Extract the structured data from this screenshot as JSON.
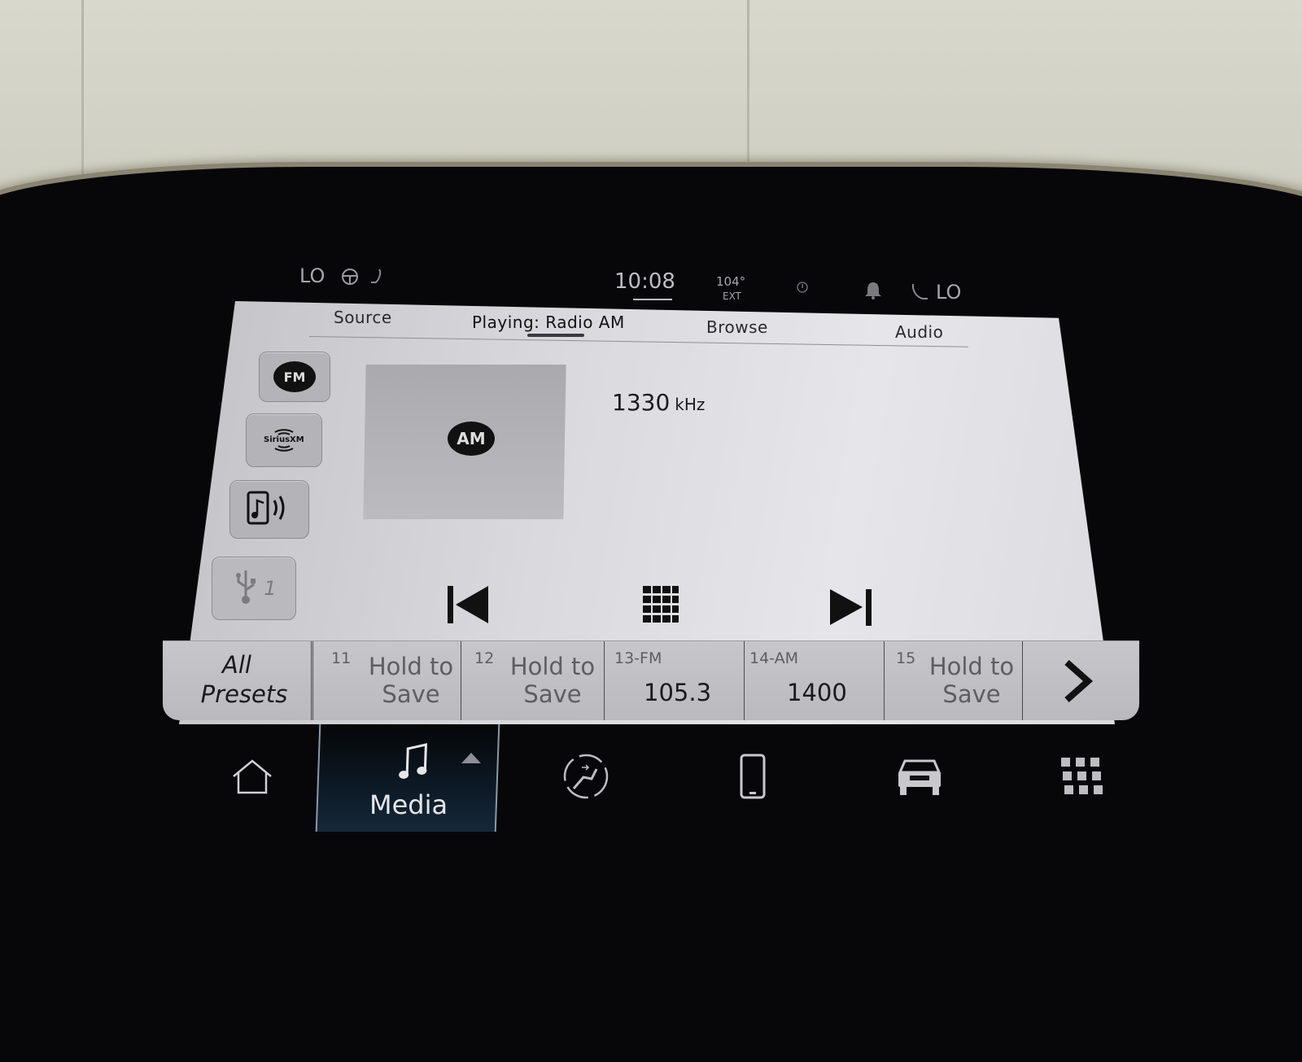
{
  "status_bar": {
    "left_climate_level": "LO",
    "right_climate_level": "LO",
    "left_icons": [
      "heated-steering-wheel-icon",
      "heated-seat-icon"
    ],
    "clock": "10:08",
    "outside_temp": "104°",
    "outside_temp_label": "EXT",
    "right_icons": [
      "info-alert-icon",
      "notification-bell-icon",
      "heated-seat-icon"
    ]
  },
  "media_tabs": [
    {
      "label": "Source",
      "active": false
    },
    {
      "label": "Playing: Radio AM",
      "active": true
    },
    {
      "label": "Browse",
      "active": false
    },
    {
      "label": "Audio",
      "active": false
    }
  ],
  "sources": [
    {
      "id": "fm",
      "label": "FM",
      "icon": "fm-radio-icon"
    },
    {
      "id": "siriusxm",
      "label": "SiriusXM",
      "icon": "siriusxm-icon"
    },
    {
      "id": "bluetooth",
      "label": "",
      "icon": "bluetooth-audio-icon"
    },
    {
      "id": "usb",
      "label": "1",
      "icon": "usb-icon"
    }
  ],
  "now_playing": {
    "band": "AM",
    "frequency": "1330",
    "unit": "kHz"
  },
  "controls": {
    "previous": "seek-back-icon",
    "direct_tune": "keypad-icon",
    "next": "seek-forward-icon"
  },
  "presets": {
    "all_line1": "All",
    "all_line2": "Presets",
    "items": [
      {
        "num": "11",
        "line1": "Hold to",
        "line2": "Save"
      },
      {
        "num": "12",
        "line1": "Hold to",
        "line2": "Save"
      },
      {
        "num": "13-FM",
        "value": "105.3"
      },
      {
        "num": "14-AM",
        "value": "1400"
      },
      {
        "num": "15",
        "line1": "Hold to",
        "line2": "Save"
      }
    ],
    "next_icon": "chevron-right-icon"
  },
  "nav_bar": {
    "items": [
      {
        "id": "home",
        "icon": "home-icon",
        "label": ""
      },
      {
        "id": "media",
        "icon": "music-note-icon",
        "label": "Media",
        "active": true
      },
      {
        "id": "comfort",
        "icon": "seat-comfort-icon",
        "label": ""
      },
      {
        "id": "phone",
        "icon": "phone-icon",
        "label": ""
      },
      {
        "id": "vehicle",
        "icon": "truck-icon",
        "label": ""
      },
      {
        "id": "apps",
        "icon": "apps-grid-icon",
        "label": ""
      }
    ]
  }
}
